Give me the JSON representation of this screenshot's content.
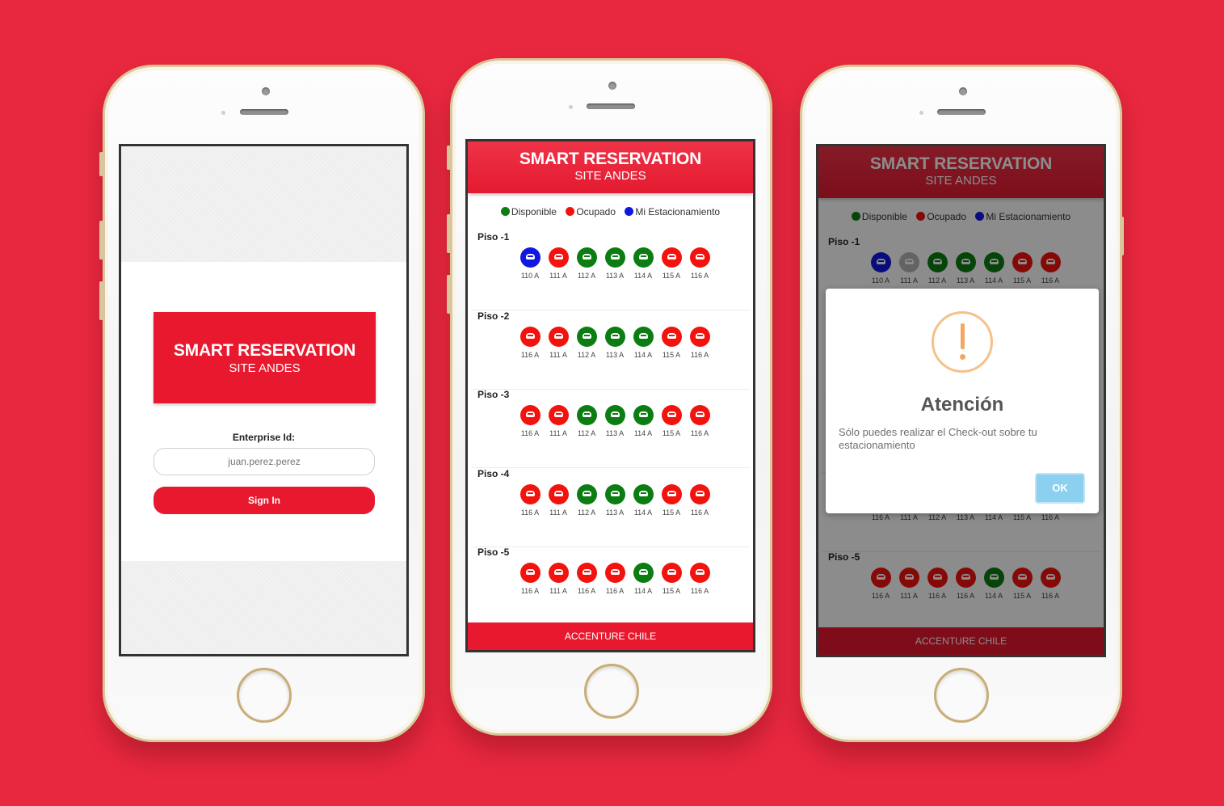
{
  "colors": {
    "background": "#e8283f",
    "brand_red": "#e8182e",
    "available": "#0b7d12",
    "occupied": "#f2130e",
    "mine": "#1018e0",
    "disabled": "#b5b5b5",
    "ok_button": "#8bd0ef",
    "warning": "#f2a860"
  },
  "login": {
    "title": "SMART RESERVATION",
    "subtitle": "SITE ANDES",
    "field_label": "Enterprise Id:",
    "field_placeholder": "juan.perez.perez",
    "sign_in_label": "Sign In"
  },
  "app": {
    "title": "SMART RESERVATION",
    "subtitle": "SITE ANDES",
    "legend": [
      {
        "label": "Disponible",
        "status": "available"
      },
      {
        "label": "Ocupado",
        "status": "occupied"
      },
      {
        "label": "Mi Estacionamiento",
        "status": "mine"
      }
    ],
    "footer": "ACCENTURE CHILE",
    "floors": [
      {
        "name": "Piso -1",
        "spots": [
          {
            "label": "110 A",
            "status": "mine"
          },
          {
            "label": "111 A",
            "status": "occupied"
          },
          {
            "label": "112 A",
            "status": "available"
          },
          {
            "label": "113 A",
            "status": "available"
          },
          {
            "label": "114 A",
            "status": "available"
          },
          {
            "label": "115 A",
            "status": "occupied"
          },
          {
            "label": "116 A",
            "status": "occupied"
          }
        ]
      },
      {
        "name": "Piso -2",
        "spots": [
          {
            "label": "116 A",
            "status": "occupied"
          },
          {
            "label": "111 A",
            "status": "occupied"
          },
          {
            "label": "112 A",
            "status": "available"
          },
          {
            "label": "113 A",
            "status": "available"
          },
          {
            "label": "114 A",
            "status": "available"
          },
          {
            "label": "115 A",
            "status": "occupied"
          },
          {
            "label": "116 A",
            "status": "occupied"
          }
        ]
      },
      {
        "name": "Piso -3",
        "spots": [
          {
            "label": "116 A",
            "status": "occupied"
          },
          {
            "label": "111 A",
            "status": "occupied"
          },
          {
            "label": "112 A",
            "status": "available"
          },
          {
            "label": "113 A",
            "status": "available"
          },
          {
            "label": "114 A",
            "status": "available"
          },
          {
            "label": "115 A",
            "status": "occupied"
          },
          {
            "label": "116 A",
            "status": "occupied"
          }
        ]
      },
      {
        "name": "Piso -4",
        "spots": [
          {
            "label": "116 A",
            "status": "occupied"
          },
          {
            "label": "111 A",
            "status": "occupied"
          },
          {
            "label": "112 A",
            "status": "available"
          },
          {
            "label": "113 A",
            "status": "available"
          },
          {
            "label": "114 A",
            "status": "available"
          },
          {
            "label": "115 A",
            "status": "occupied"
          },
          {
            "label": "116 A",
            "status": "occupied"
          }
        ]
      },
      {
        "name": "Piso -5",
        "spots": [
          {
            "label": "116 A",
            "status": "occupied"
          },
          {
            "label": "111 A",
            "status": "occupied"
          },
          {
            "label": "116 A",
            "status": "occupied"
          },
          {
            "label": "116 A",
            "status": "occupied"
          },
          {
            "label": "114 A",
            "status": "available"
          },
          {
            "label": "115 A",
            "status": "occupied"
          },
          {
            "label": "116 A",
            "status": "occupied"
          }
        ]
      }
    ]
  },
  "dialog": {
    "icon": "exclamation-warning-icon",
    "title": "Atención",
    "message": "Sólo puedes realizar el Check-out sobre tu estacionamiento",
    "ok_label": "OK",
    "floor1_statuses": [
      "mine",
      "disabled",
      "available",
      "available",
      "available",
      "occupied",
      "occupied"
    ],
    "floor4_labels": [
      "116 A",
      "111 A",
      "112 A",
      "113 A",
      "114 A",
      "115 A",
      "116 A"
    ]
  }
}
